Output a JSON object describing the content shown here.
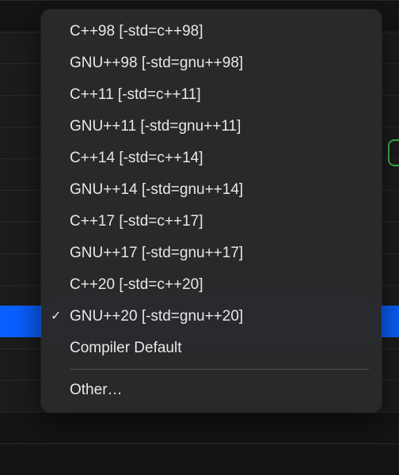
{
  "menu": {
    "items": [
      {
        "label": "C++98 [-std=c++98]",
        "selected": false
      },
      {
        "label": "GNU++98 [-std=gnu++98]",
        "selected": false
      },
      {
        "label": "C++11 [-std=c++11]",
        "selected": false
      },
      {
        "label": "GNU++11 [-std=gnu++11]",
        "selected": false
      },
      {
        "label": "C++14 [-std=c++14]",
        "selected": false
      },
      {
        "label": "GNU++14 [-std=gnu++14]",
        "selected": false
      },
      {
        "label": "C++17 [-std=c++17]",
        "selected": false
      },
      {
        "label": "GNU++17 [-std=gnu++17]",
        "selected": false
      },
      {
        "label": "C++20 [-std=c++20]",
        "selected": false
      },
      {
        "label": "GNU++20 [-std=gnu++20]",
        "selected": true
      },
      {
        "label": "Compiler Default",
        "selected": false
      }
    ],
    "other_label": "Other…",
    "checkmark": "✓"
  }
}
